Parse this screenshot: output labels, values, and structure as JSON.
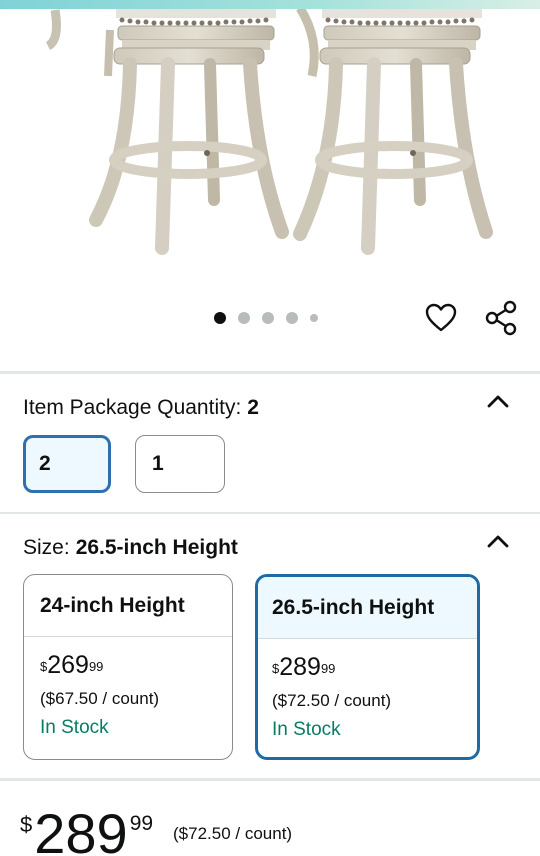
{
  "gallery": {
    "image_alt": "Two swivel counter stools",
    "dots_total": 5,
    "active_dot": 0
  },
  "quantity": {
    "label": "Item Package Quantity:",
    "selected_value": "2",
    "options": [
      {
        "label": "2",
        "selected": true
      },
      {
        "label": "1",
        "selected": false
      }
    ]
  },
  "size": {
    "label": "Size:",
    "selected_value": "26.5-inch Height",
    "options": [
      {
        "title": "24-inch Height",
        "currency": "$",
        "price_whole": "269",
        "price_fraction": "99",
        "unit_price": "($67.50 / count)",
        "availability": "In Stock",
        "selected": false
      },
      {
        "title": "26.5-inch Height",
        "currency": "$",
        "price_whole": "289",
        "price_fraction": "99",
        "unit_price": "($72.50 / count)",
        "availability": "In Stock",
        "selected": true
      }
    ]
  },
  "price": {
    "currency": "$",
    "whole": "289",
    "fraction": "99",
    "unit_price": "($72.50 / count)"
  },
  "colors": {
    "selected_border": "#1f6aa5",
    "selected_bg": "#edf8ff",
    "in_stock": "#067d62"
  },
  "icons": [
    "heart-icon",
    "share-icon",
    "chevron-up-icon"
  ]
}
